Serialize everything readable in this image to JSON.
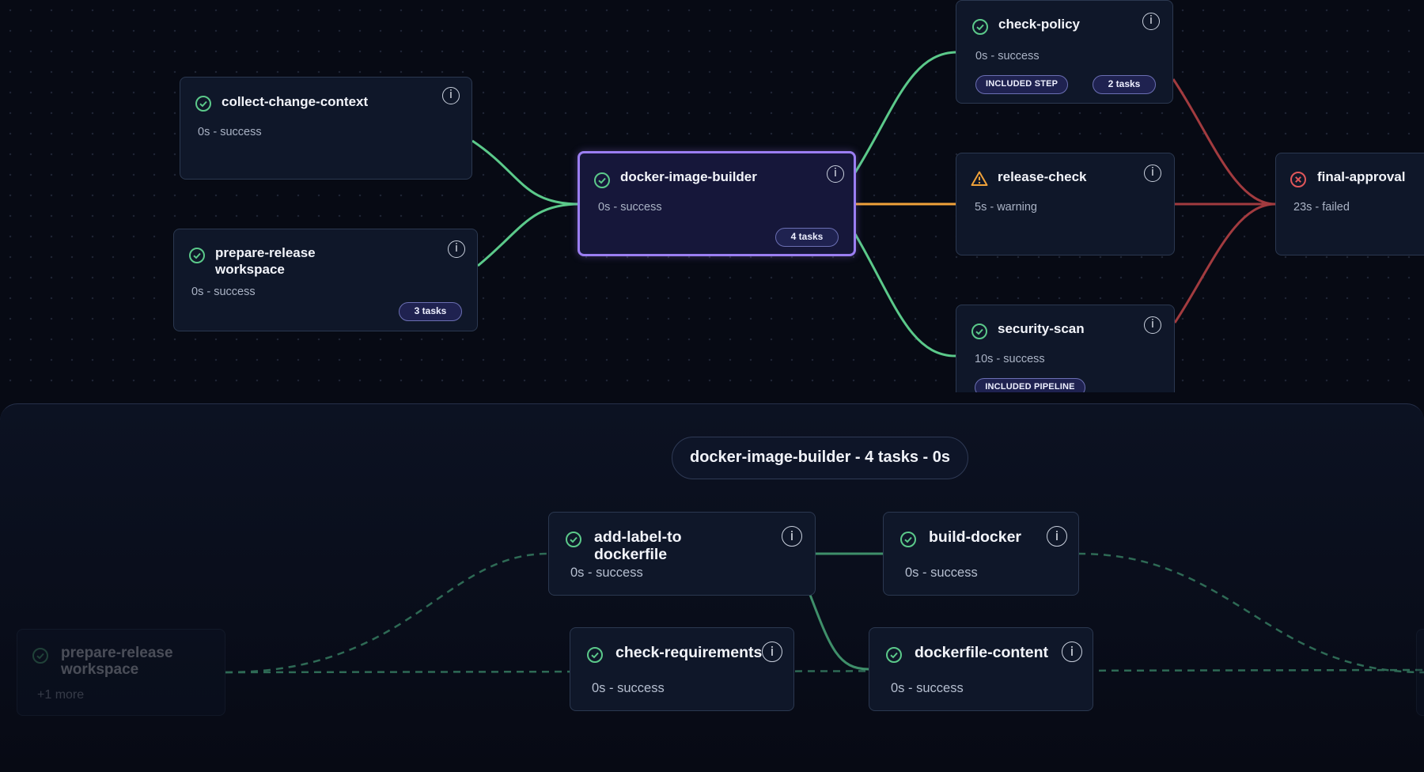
{
  "colors": {
    "success": "#5bc98a",
    "warning": "#f0a23a",
    "failed": "#e0565a",
    "selected_border": "#9b7ef2",
    "edge_success": "#5bc98a",
    "edge_warning": "#f0a23a",
    "edge_failed": "#a23b3f"
  },
  "pipeline": {
    "nodes": [
      {
        "id": "collect-change-context",
        "title": "collect-change-context",
        "subtitle": "0s - success",
        "status": "success"
      },
      {
        "id": "prepare-release-workspace",
        "title_line1": "prepare-release",
        "title_line2": "workspace",
        "subtitle": "0s - success",
        "status": "success",
        "tasks": "3 tasks"
      },
      {
        "id": "docker-image-builder",
        "title": "docker-image-builder",
        "subtitle": "0s - success",
        "status": "success",
        "tasks": "4 tasks",
        "selected": true
      },
      {
        "id": "check-policy",
        "title": "check-policy",
        "subtitle": "0s - success",
        "status": "success",
        "tag": "INCLUDED STEP",
        "tasks": "2 tasks"
      },
      {
        "id": "release-check",
        "title": "release-check",
        "subtitle": "5s - warning",
        "status": "warning"
      },
      {
        "id": "security-scan",
        "title": "security-scan",
        "subtitle": "10s - success",
        "status": "success",
        "tag": "INCLUDED PIPELINE"
      },
      {
        "id": "final-approval",
        "title": "final-approval",
        "subtitle": "23s - failed",
        "status": "failed"
      }
    ],
    "info_label": "i"
  },
  "detail_panel": {
    "title": "docker-image-builder - 4 tasks - 0s",
    "nodes": [
      {
        "id": "add-label-to-dockerfile",
        "title_line1": "add-label-to",
        "title_line2": "dockerfile",
        "subtitle": "0s - success",
        "status": "success"
      },
      {
        "id": "build-docker",
        "title": "build-docker",
        "subtitle": "0s - success",
        "status": "success"
      },
      {
        "id": "check-requirements",
        "title": "check-requirements",
        "subtitle": "0s - success",
        "status": "success"
      },
      {
        "id": "dockerfile-content",
        "title": "dockerfile-content",
        "subtitle": "0s - success",
        "status": "success"
      }
    ],
    "ghost_node": {
      "title_line1": "prepare-release",
      "title_line2": "workspace",
      "subtitle": "+1 more"
    }
  }
}
